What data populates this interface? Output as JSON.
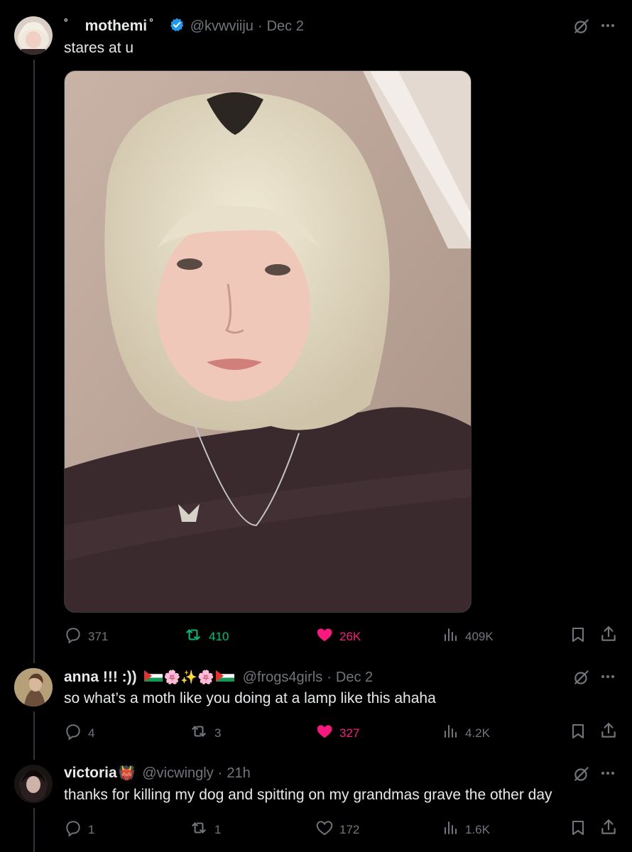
{
  "tweets": [
    {
      "display_name": "mothemi",
      "name_deco_left": "°",
      "name_deco_right": "°",
      "verified": true,
      "handle": "@kvwviiju",
      "sep": "·",
      "date": "Dec 2",
      "text": "stares at u",
      "has_media": true,
      "replies": "371",
      "reposts": "410",
      "likes": "26K",
      "views": "409K",
      "liked": true,
      "reposted": true
    },
    {
      "display_name": "anna !!! :))",
      "emoji": "🌸✨🌸",
      "handle": "@frogs4girls",
      "sep": "·",
      "date": "Dec 2",
      "text": "so what’s a moth like you doing at a lamp like this ahaha",
      "replies": "4",
      "reposts": "3",
      "likes": "327",
      "views": "4.2K",
      "liked": true,
      "reposted": false
    },
    {
      "display_name": "victoria",
      "emoji": "👹",
      "handle": "@vicwingly",
      "sep": "·",
      "date": "21h",
      "text": "thanks for killing my dog and spitting on my grandmas grave the other day",
      "replies": "1",
      "reposts": "1",
      "likes": "172",
      "views": "1.6K",
      "liked": false,
      "reposted": false
    }
  ],
  "colors": {
    "background": "#000000",
    "text": "#e7e9ea",
    "muted": "#71767b",
    "like": "#f91880",
    "repost": "#00ba7c",
    "verified": "#1d9bf0"
  },
  "icons": [
    "grok-icon",
    "more-icon",
    "reply-icon",
    "repost-icon",
    "like-icon",
    "views-icon",
    "bookmark-icon",
    "share-icon",
    "verified-badge-icon"
  ]
}
